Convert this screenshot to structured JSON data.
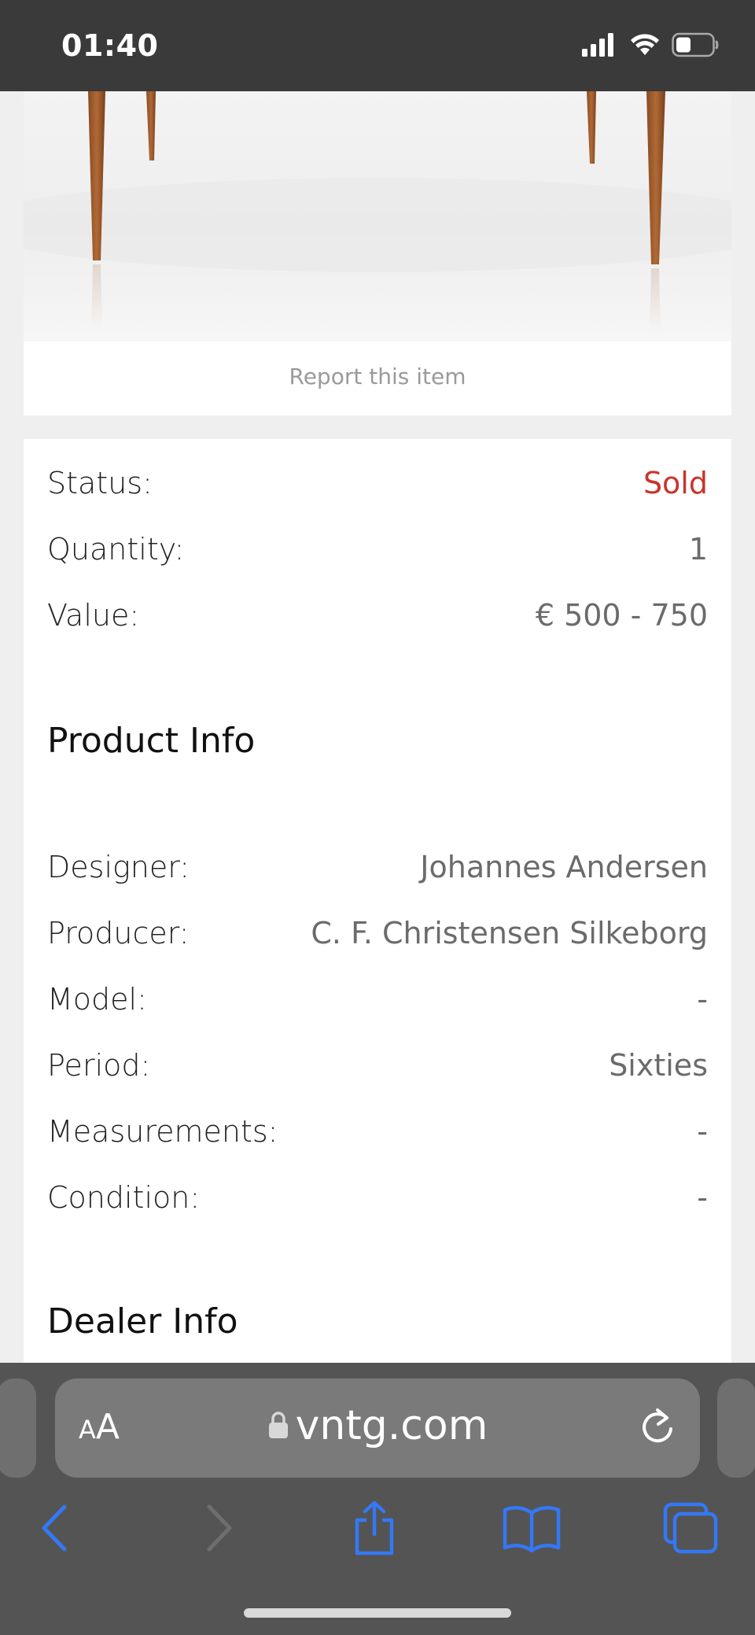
{
  "status_bar": {
    "time": "01:40"
  },
  "image_card": {
    "report_label": "Report this item"
  },
  "summary": [
    {
      "label": "Status:",
      "value": "Sold"
    },
    {
      "label": "Quantity:",
      "value": "1"
    },
    {
      "label": "Value:",
      "value": "€ 500 - 750"
    }
  ],
  "product_info": {
    "title": "Product Info",
    "rows": [
      {
        "label": "Designer:",
        "value": "Johannes Andersen"
      },
      {
        "label": "Producer:",
        "value": "C. F. Christensen Silkeborg"
      },
      {
        "label": "Model:",
        "value": "-"
      },
      {
        "label": "Period:",
        "value": "Sixties"
      },
      {
        "label": "Measurements:",
        "value": "-"
      },
      {
        "label": "Condition:",
        "value": "-"
      }
    ]
  },
  "dealer_info": {
    "title": "Dealer Info"
  },
  "browser": {
    "text_size_label_small": "A",
    "text_size_label_large": "A",
    "url": "vntg.com"
  },
  "colors": {
    "sold": "#c8352b",
    "accent": "#3478f6"
  },
  "icons": [
    "signal-icon",
    "wifi-icon",
    "battery-icon",
    "lock-icon",
    "reload-icon",
    "back-icon",
    "forward-icon",
    "share-icon",
    "bookmarks-icon",
    "tabs-icon"
  ]
}
